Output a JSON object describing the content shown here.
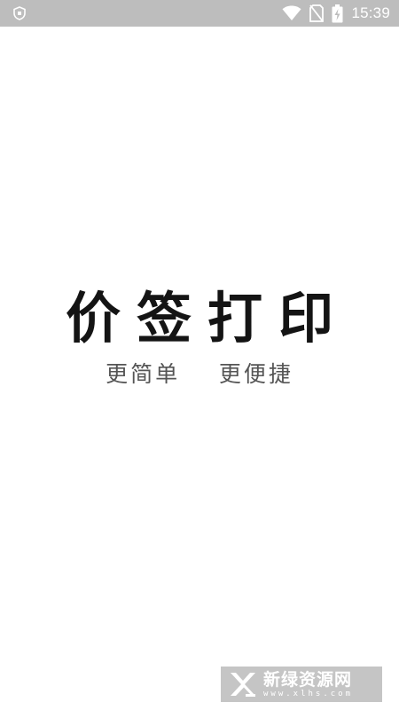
{
  "status_bar": {
    "time": "15:39",
    "icons": [
      "shield-icon",
      "wifi-icon",
      "no-sim-icon",
      "battery-charging-icon"
    ]
  },
  "splash": {
    "title": "价签打印",
    "slogan": "更简单    更便捷"
  },
  "watermark": {
    "title": "新绿资源网",
    "url": "www.xlhs.com"
  },
  "colors": {
    "status_bar_bg": "#bdbdbd",
    "title_text": "#141414",
    "slogan_text": "#555555"
  }
}
